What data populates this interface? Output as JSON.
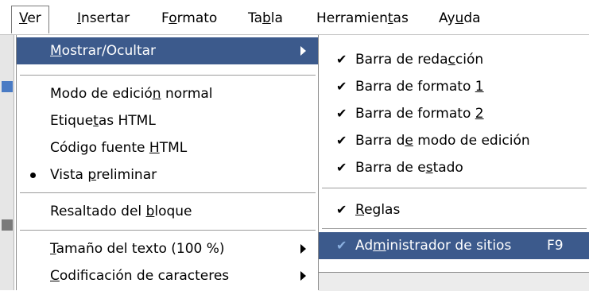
{
  "menubar": {
    "items": [
      {
        "pre": "",
        "u": "V",
        "post": "er"
      },
      {
        "pre": "",
        "u": "I",
        "post": "nsertar"
      },
      {
        "pre": "F",
        "u": "o",
        "post": "rmato"
      },
      {
        "pre": "Ta",
        "u": "b",
        "post": "la"
      },
      {
        "pre": "Herramien",
        "u": "t",
        "post": "as"
      },
      {
        "pre": "Ay",
        "u": "u",
        "post": "da"
      }
    ]
  },
  "view_menu": {
    "items": [
      {
        "pre": "",
        "u": "M",
        "post": "ostrar/Ocultar",
        "submenu": true,
        "highlighted": true
      },
      {
        "pre": "Modo de edició",
        "u": "n",
        "post": " normal"
      },
      {
        "pre": "Etique",
        "u": "t",
        "post": "as HTML"
      },
      {
        "pre": "Código fuente ",
        "u": "H",
        "post": "TML"
      },
      {
        "pre": "Vista ",
        "u": "p",
        "post": "reliminar",
        "selected": true
      },
      {
        "pre": "Resaltado del ",
        "u": "b",
        "post": "loque"
      },
      {
        "pre": "",
        "u": "T",
        "post": "amaño del texto (100 %)",
        "submenu": true
      },
      {
        "pre": "",
        "u": "C",
        "post": "odificación de caracteres",
        "submenu": true
      }
    ]
  },
  "show_hide_submenu": {
    "items": [
      {
        "pre": "Barra de reda",
        "u": "c",
        "post": "ción",
        "checked": true
      },
      {
        "pre": "Barra de formato ",
        "u": "1",
        "post": "",
        "checked": true
      },
      {
        "pre": "Barra de formato ",
        "u": "2",
        "post": "",
        "checked": true
      },
      {
        "pre": "Barra d",
        "u": "e",
        "post": " modo de edición",
        "checked": true
      },
      {
        "pre": "Barra de e",
        "u": "s",
        "post": "tado",
        "checked": true
      },
      {
        "pre": "",
        "u": "R",
        "post": "eglas",
        "checked": true
      },
      {
        "pre": "Ad",
        "u": "m",
        "post": "inistrador de sitios",
        "checked": true,
        "highlighted": true,
        "shortcut": "F9"
      }
    ]
  },
  "icons": {
    "check": "check-icon",
    "bullet": "radio-bullet-icon",
    "submenu_arrow": "chevron-right-icon"
  },
  "colors": {
    "highlight": "#3c5a8c",
    "highlight_text": "#ffffff",
    "disabled_check": "#8ab0e0"
  }
}
